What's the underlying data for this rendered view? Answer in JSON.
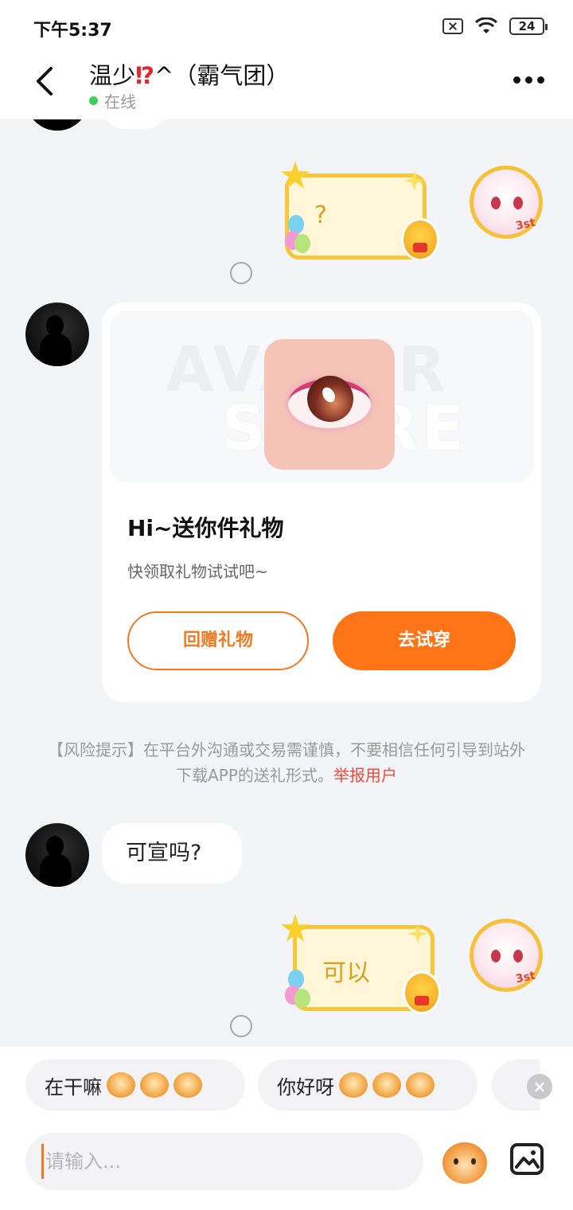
{
  "status_bar": {
    "time": "下午5:37",
    "battery": "24"
  },
  "header": {
    "title_name": "温少",
    "title_emoji": "⁉",
    "title_suffix": "^（霸气团）",
    "online_status": "在线"
  },
  "messages": {
    "sticker_1_text": "?",
    "gift_card": {
      "watermark_line1": "AVATAR",
      "watermark_line2": "STORE",
      "title": "Hi~送你件礼物",
      "subtitle": "快领取礼物试试吧~",
      "return_gift_label": "回赠礼物",
      "try_on_label": "去试穿"
    },
    "risk_notice_text": "【风险提示】在平台外沟通或交易需谨慎，不要相信任何引导到站外下载APP的送礼形式。",
    "risk_report_link": "举报用户",
    "text_message": "可宣吗?",
    "sticker_2_text": "可以",
    "self_badge": "3st"
  },
  "quick_replies": [
    {
      "label": "在干嘛"
    },
    {
      "label": "你好呀"
    }
  ],
  "composer": {
    "placeholder": "请输入..."
  },
  "colors": {
    "accent": "#fe7417",
    "online": "#3ccf56",
    "report_link": "#ef4a38",
    "sticker_border": "#f7c739"
  },
  "icons": [
    "back-arrow-icon",
    "more-dots-icon",
    "sticker-icon",
    "image-icon",
    "close-icon",
    "wifi-icon",
    "sim-icon",
    "battery-icon"
  ]
}
